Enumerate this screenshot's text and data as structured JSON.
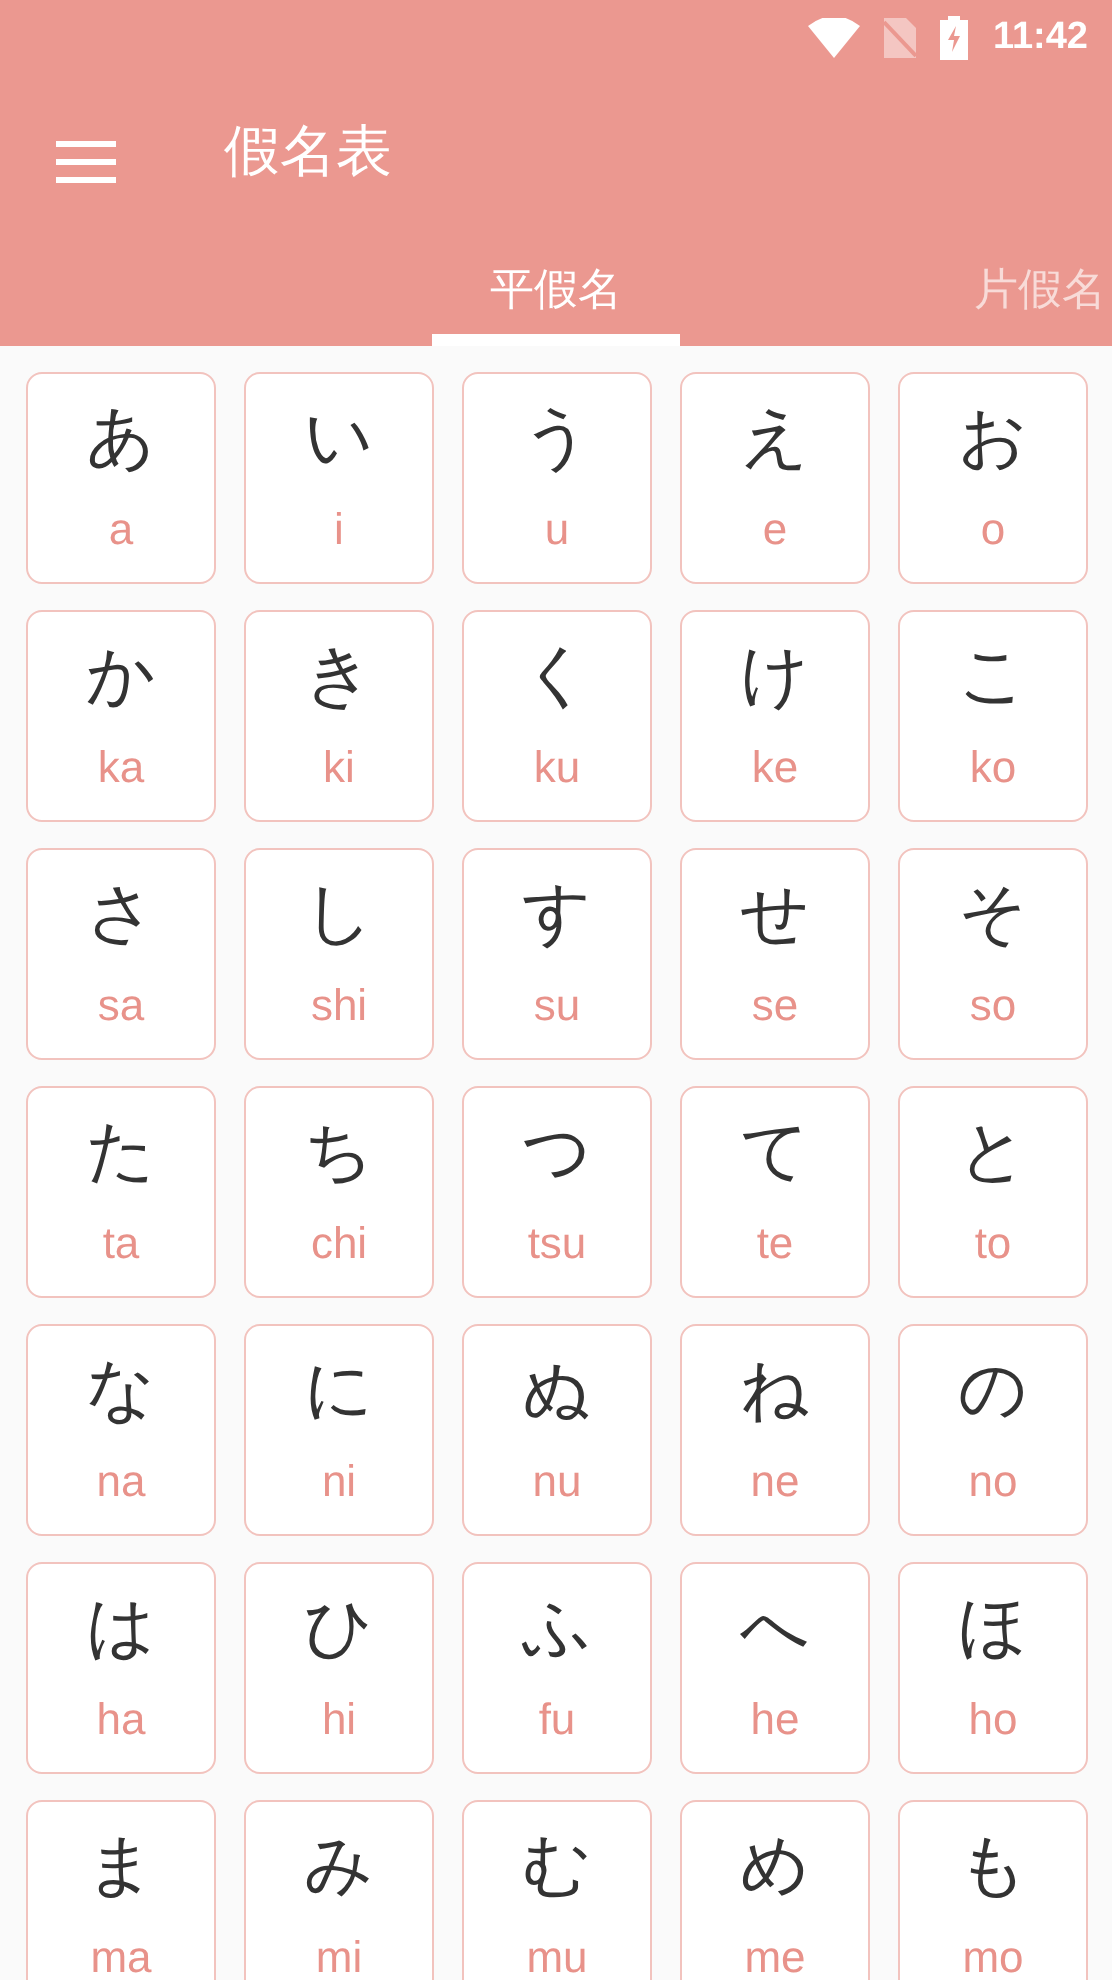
{
  "status_bar": {
    "time": "11:42"
  },
  "app_bar": {
    "title": "假名表"
  },
  "tabs": [
    {
      "label": "平假名",
      "selected": true
    },
    {
      "label": "片假名",
      "selected": false
    }
  ],
  "cards": [
    {
      "kana": "あ",
      "romaji": "a"
    },
    {
      "kana": "い",
      "romaji": "i"
    },
    {
      "kana": "う",
      "romaji": "u"
    },
    {
      "kana": "え",
      "romaji": "e"
    },
    {
      "kana": "お",
      "romaji": "o"
    },
    {
      "kana": "か",
      "romaji": "ka"
    },
    {
      "kana": "き",
      "romaji": "ki"
    },
    {
      "kana": "く",
      "romaji": "ku"
    },
    {
      "kana": "け",
      "romaji": "ke"
    },
    {
      "kana": "こ",
      "romaji": "ko"
    },
    {
      "kana": "さ",
      "romaji": "sa"
    },
    {
      "kana": "し",
      "romaji": "shi"
    },
    {
      "kana": "す",
      "romaji": "su"
    },
    {
      "kana": "せ",
      "romaji": "se"
    },
    {
      "kana": "そ",
      "romaji": "so"
    },
    {
      "kana": "た",
      "romaji": "ta"
    },
    {
      "kana": "ち",
      "romaji": "chi"
    },
    {
      "kana": "つ",
      "romaji": "tsu"
    },
    {
      "kana": "て",
      "romaji": "te"
    },
    {
      "kana": "と",
      "romaji": "to"
    },
    {
      "kana": "な",
      "romaji": "na"
    },
    {
      "kana": "に",
      "romaji": "ni"
    },
    {
      "kana": "ぬ",
      "romaji": "nu"
    },
    {
      "kana": "ね",
      "romaji": "ne"
    },
    {
      "kana": "の",
      "romaji": "no"
    },
    {
      "kana": "は",
      "romaji": "ha"
    },
    {
      "kana": "ひ",
      "romaji": "hi"
    },
    {
      "kana": "ふ",
      "romaji": "fu"
    },
    {
      "kana": "へ",
      "romaji": "he"
    },
    {
      "kana": "ほ",
      "romaji": "ho"
    },
    {
      "kana": "ま",
      "romaji": "ma"
    },
    {
      "kana": "み",
      "romaji": "mi"
    },
    {
      "kana": "む",
      "romaji": "mu"
    },
    {
      "kana": "め",
      "romaji": "me"
    },
    {
      "kana": "も",
      "romaji": "mo"
    }
  ]
}
